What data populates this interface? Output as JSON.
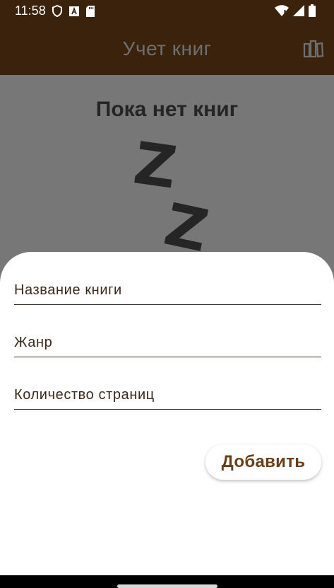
{
  "status_bar": {
    "time": "11:58",
    "left_icons": [
      "shield-icon",
      "a-icon",
      "sd-card-icon"
    ],
    "right_icons": [
      "wifi-icon",
      "signal-icon",
      "battery-icon"
    ]
  },
  "app_bar": {
    "title": "Учет книг",
    "action_icon": "book-stack-icon",
    "background": "#3a220c"
  },
  "content": {
    "empty_title": "Пока нет книг",
    "sleep_letters": [
      "Z",
      "Z"
    ]
  },
  "sheet": {
    "fields": [
      {
        "placeholder": "Название книги",
        "value": ""
      },
      {
        "placeholder": "Жанр",
        "value": ""
      },
      {
        "placeholder": "Количество страниц",
        "value": ""
      }
    ],
    "add_button_label": "Добавить",
    "accent": "#6a3e18"
  }
}
